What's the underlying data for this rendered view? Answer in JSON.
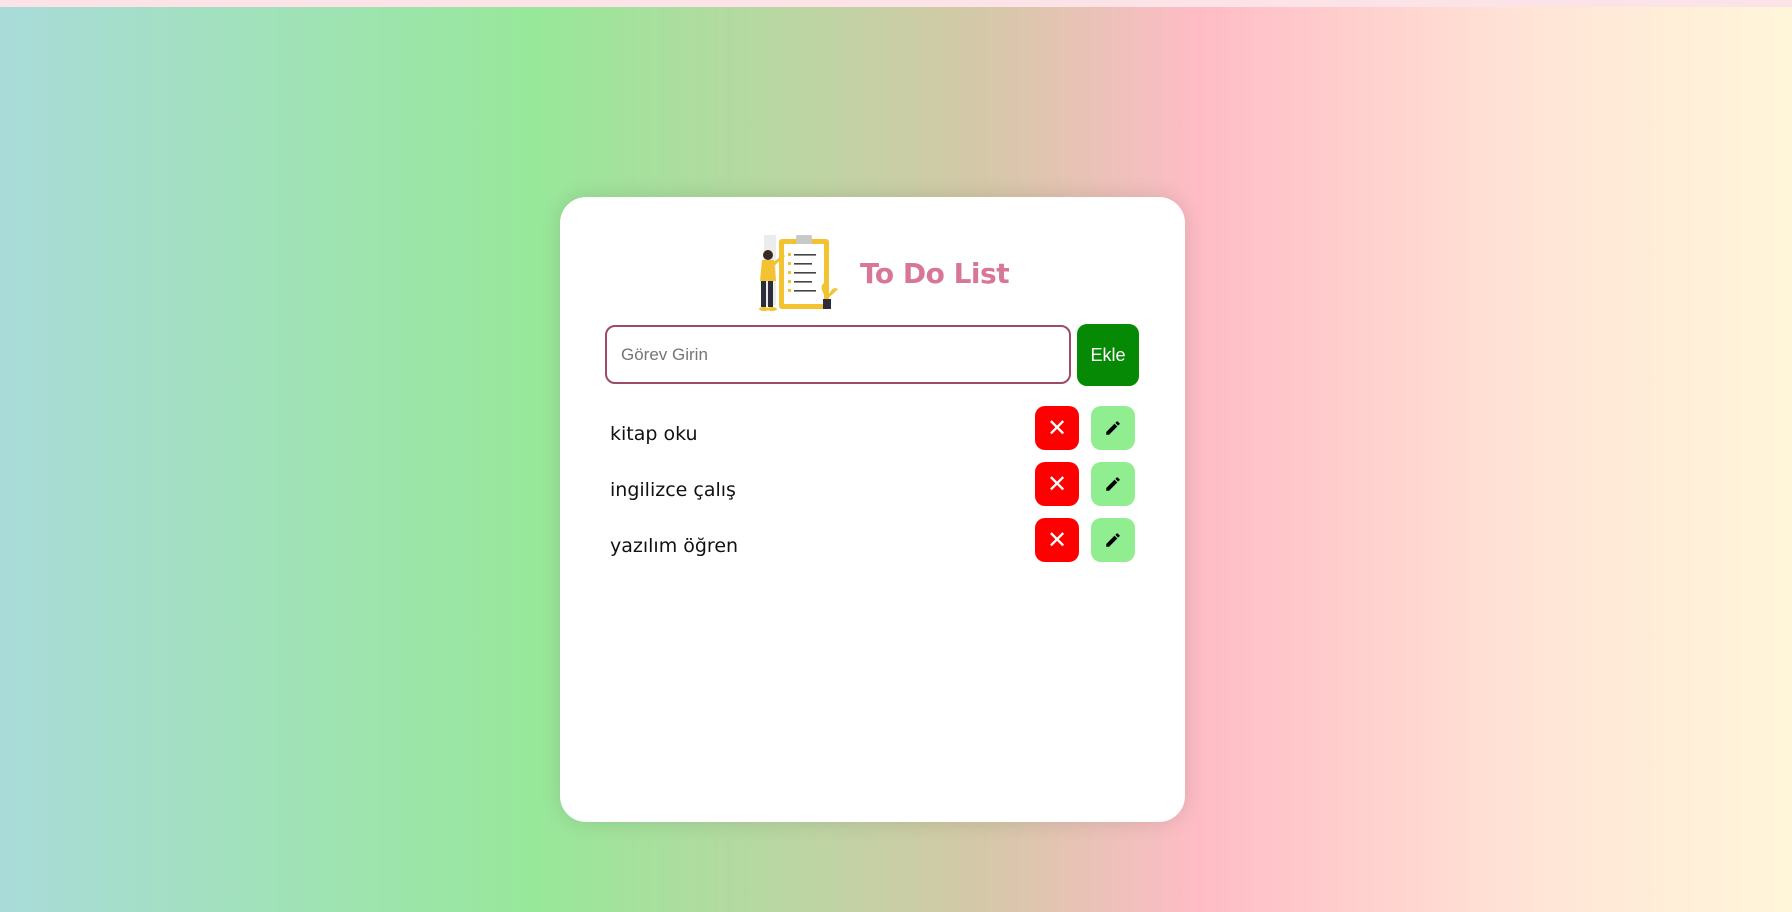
{
  "app": {
    "title": "To Do List"
  },
  "form": {
    "placeholder": "Görev Girin",
    "value": "",
    "add_label": "Ekle"
  },
  "tasks": [
    {
      "text": "kitap oku"
    },
    {
      "text": "ingilizce çalış"
    },
    {
      "text": "yazılım öğren"
    }
  ],
  "icons": {
    "delete": "close-icon",
    "edit": "pencil-icon",
    "illustration": "checklist-illustration"
  },
  "colors": {
    "title": "#d77697",
    "add_button": "#068a06",
    "delete_button": "#ff0000",
    "edit_button": "#90ee90",
    "input_border": "#a04a6a"
  }
}
